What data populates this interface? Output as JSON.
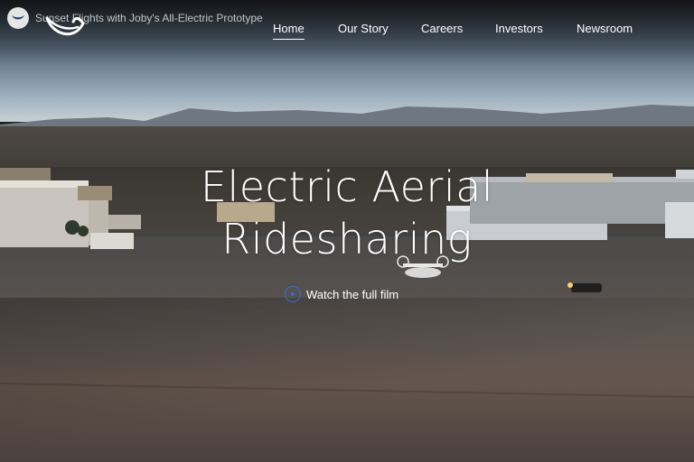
{
  "video": {
    "title": "Sunset Flights with Joby's All-Electric Prototype"
  },
  "nav": {
    "items": [
      {
        "label": "Home",
        "active": true
      },
      {
        "label": "Our Story",
        "active": false
      },
      {
        "label": "Careers",
        "active": false
      },
      {
        "label": "Investors",
        "active": false
      },
      {
        "label": "Newsroom",
        "active": false
      }
    ]
  },
  "hero": {
    "headline_line1": "Electric Aerial",
    "headline_line2": "Ridesharing",
    "watch_label": "Watch the full film",
    "watch_icon": "play-circle-icon",
    "accent_color": "#2f6fd6"
  }
}
